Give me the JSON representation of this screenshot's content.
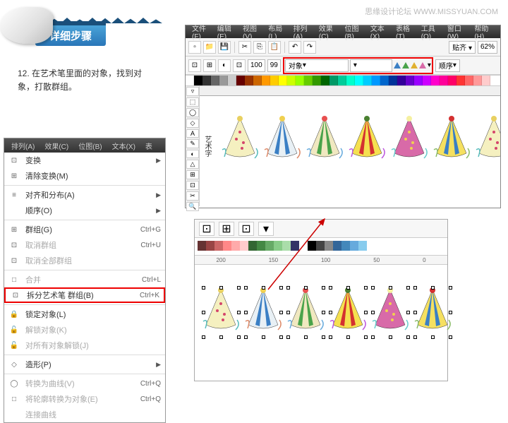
{
  "watermark": "思缘设计论坛  WWW.MISSYUAN.COM",
  "banner_title": "详细步骤",
  "instruction": {
    "num": "12.",
    "text": "在艺术笔里面的对象，找到对象，打散群组。"
  },
  "context_menu": {
    "tabs": [
      "排列(A)",
      "效果(C)",
      "位图(B)",
      "文本(X)",
      "表"
    ],
    "items": [
      {
        "icon": "⊡",
        "label": "变换",
        "shortcut": "",
        "arrow": true,
        "enabled": true
      },
      {
        "icon": "⊞",
        "label": "清除变换(M)",
        "shortcut": "",
        "enabled": true
      },
      {
        "sep": true
      },
      {
        "icon": "≡",
        "label": "对齐和分布(A)",
        "shortcut": "",
        "arrow": true,
        "enabled": true
      },
      {
        "icon": "",
        "label": "顺序(O)",
        "shortcut": "",
        "arrow": true,
        "enabled": true
      },
      {
        "sep": true
      },
      {
        "icon": "⊞",
        "label": "群组(G)",
        "shortcut": "Ctrl+G",
        "enabled": true
      },
      {
        "icon": "⊡",
        "label": "取消群组",
        "shortcut": "Ctrl+U",
        "enabled": false
      },
      {
        "icon": "⊡",
        "label": "取消全部群组",
        "shortcut": "",
        "enabled": false
      },
      {
        "sep": true
      },
      {
        "icon": "□",
        "label": "合并",
        "shortcut": "Ctrl+L",
        "enabled": false
      },
      {
        "icon": "⊡",
        "label": "拆分艺术笔 群组(B)",
        "shortcut": "Ctrl+K",
        "enabled": true,
        "highlight": true
      },
      {
        "sep": true
      },
      {
        "icon": "🔒",
        "label": "锁定对象(L)",
        "shortcut": "",
        "enabled": true
      },
      {
        "icon": "🔓",
        "label": "解锁对象(K)",
        "shortcut": "",
        "enabled": false
      },
      {
        "icon": "🔓",
        "label": "对所有对象解锁(J)",
        "shortcut": "",
        "enabled": false
      },
      {
        "sep": true
      },
      {
        "icon": "◇",
        "label": "造形(P)",
        "shortcut": "",
        "arrow": true,
        "enabled": true
      },
      {
        "sep": true
      },
      {
        "icon": "◯",
        "label": "转换为曲线(V)",
        "shortcut": "Ctrl+Q",
        "enabled": false
      },
      {
        "icon": "□",
        "label": "将轮廓转换为对象(E)",
        "shortcut": "Ctrl+Q",
        "enabled": false
      },
      {
        "icon": "",
        "label": "连接曲线",
        "shortcut": "",
        "enabled": false
      }
    ]
  },
  "app": {
    "menus": [
      "文件(F)",
      "编辑(E)",
      "视图(V)",
      "布局(L)",
      "排列(A)",
      "效果(C)",
      "位图(B)",
      "文本(X)",
      "表格(T)",
      "工具(O)",
      "窗口(W)",
      "帮助(H)"
    ],
    "spin1": "100",
    "spin2": "99",
    "spin3": "62%",
    "dropdown1": "对象",
    "dropdown2": "贴齐 ▾",
    "dropdown3": "顺序",
    "canvas_label": "艺术字",
    "palette": [
      "#ffffff",
      "#000000",
      "#333333",
      "#666666",
      "#999999",
      "#cccccc",
      "#660000",
      "#993300",
      "#cc6600",
      "#ff9900",
      "#ffcc00",
      "#ffff00",
      "#ccff00",
      "#99ff00",
      "#66cc00",
      "#339900",
      "#006600",
      "#009966",
      "#00cc99",
      "#00ffcc",
      "#00ffff",
      "#00ccff",
      "#0099ff",
      "#0066cc",
      "#003399",
      "#330099",
      "#6600cc",
      "#9900ff",
      "#cc00ff",
      "#ff00cc",
      "#ff0099",
      "#ff0066",
      "#ff3333",
      "#ff6666",
      "#ff9999",
      "#ffcccc"
    ],
    "triangles": [
      "#3b7fc4",
      "#4aa34a",
      "#e0b030",
      "#d86aa8"
    ],
    "tools": [
      "▿",
      "⬚",
      "◯",
      "◇",
      "A",
      "✎",
      "◐",
      "△",
      "⊞",
      "⊡",
      "✂",
      "🔍"
    ]
  },
  "bottom": {
    "ruler": [
      "200",
      "150",
      "100",
      "50",
      "0"
    ],
    "palette": [
      "#663333",
      "#994444",
      "#cc6666",
      "#ff8888",
      "#ffaaaa",
      "#ffcccc",
      "#336633",
      "#448844",
      "#66aa66",
      "#88cc88",
      "#aaddaa",
      "#333366",
      "#ffffff",
      "#000000",
      "#444444",
      "#888888",
      "#336699",
      "#4488bb",
      "#66aadd",
      "#88ccee"
    ]
  }
}
